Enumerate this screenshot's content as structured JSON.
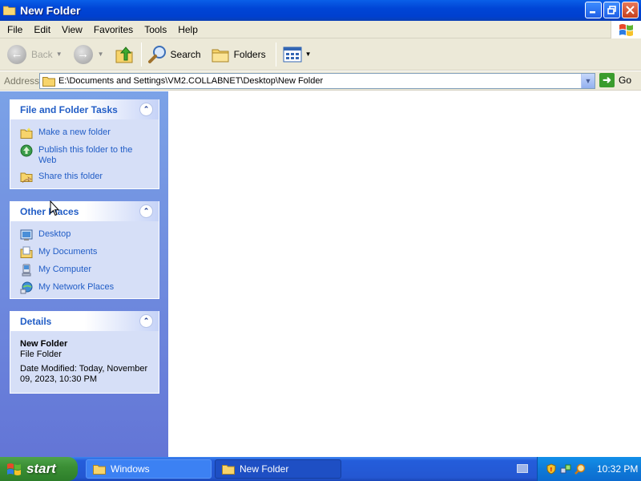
{
  "window": {
    "title": "New Folder"
  },
  "menu": [
    "File",
    "Edit",
    "View",
    "Favorites",
    "Tools",
    "Help"
  ],
  "toolbar": {
    "back": "Back",
    "search": "Search",
    "folders": "Folders"
  },
  "address": {
    "label": "Address",
    "value": "E:\\Documents and Settings\\VM2.COLLABNET\\Desktop\\New Folder",
    "go": "Go"
  },
  "tasks_panel": {
    "title": "File and Folder Tasks",
    "items": [
      {
        "label": "Make a new folder",
        "icon": "new-folder-icon"
      },
      {
        "label": "Publish this folder to the Web",
        "icon": "publish-web-icon"
      },
      {
        "label": "Share this folder",
        "icon": "share-folder-icon"
      }
    ]
  },
  "places_panel": {
    "title": "Other Places",
    "items": [
      {
        "label": "Desktop",
        "icon": "desktop-icon"
      },
      {
        "label": "My Documents",
        "icon": "my-documents-icon"
      },
      {
        "label": "My Computer",
        "icon": "my-computer-icon"
      },
      {
        "label": "My Network Places",
        "icon": "network-places-icon"
      }
    ]
  },
  "details_panel": {
    "title": "Details",
    "name": "New Folder",
    "type": "File Folder",
    "modified": "Date Modified: Today, November 09, 2023, 10:30 PM"
  },
  "taskbar": {
    "start": "start",
    "buttons": [
      "Windows",
      "New Folder"
    ],
    "clock": "10:32 PM"
  }
}
